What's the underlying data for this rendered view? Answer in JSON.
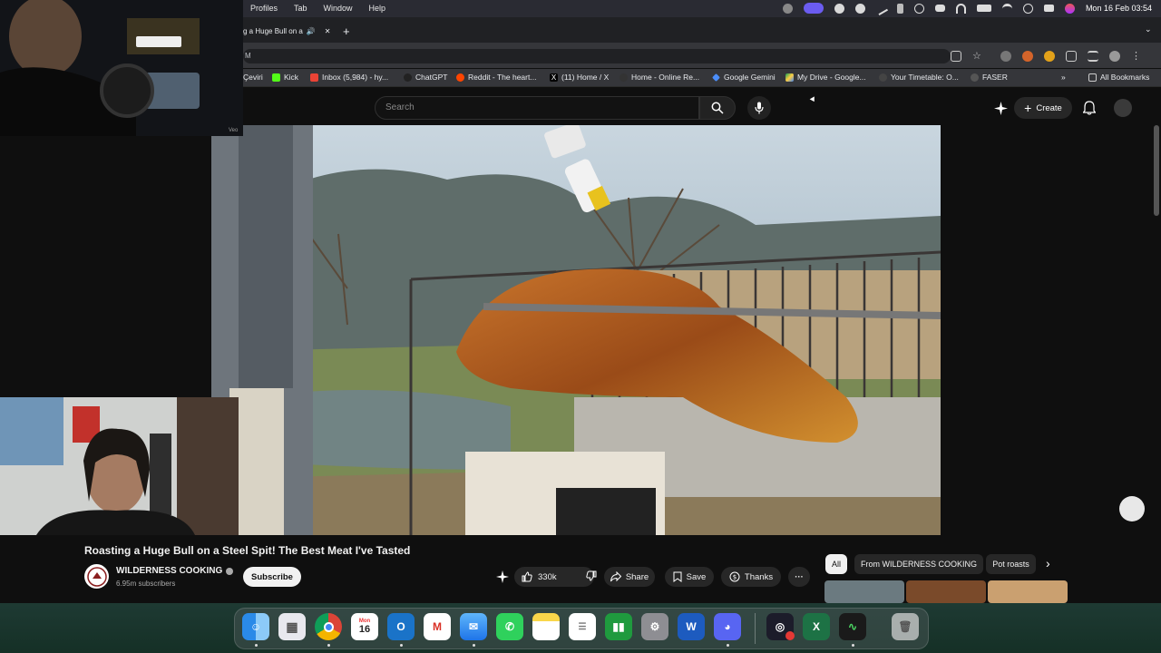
{
  "menubar": {
    "items": [
      "Profiles",
      "Tab",
      "Window",
      "Help"
    ],
    "clock": "Mon 16 Feb  03:54"
  },
  "browser": {
    "tab_title": "g a Huge Bull on a",
    "url": "M",
    "bookmarks": [
      "Çeviri",
      "Kick",
      "Inbox (5,984) - hy...",
      "ChatGPT",
      "Reddit - The heart...",
      "(11) Home / X",
      "Home - Online Re...",
      "Google Gemini",
      "My Drive - Google...",
      "Your Timetable: O...",
      "FASER"
    ],
    "all_bookmarks": "All Bookmarks",
    "more_glyph": "»"
  },
  "youtube": {
    "search_placeholder": "Search",
    "create_label": "Create",
    "video_title": "Roasting a Huge Bull on a Steel Spit! The Best Meat I've Tasted",
    "channel_name": "WILDERNESS COOKING",
    "subscribers": "6.95m subscribers",
    "subscribe_label": "Subscribe",
    "like_count": "330k",
    "share_label": "Share",
    "save_label": "Save",
    "thanks_label": "Thanks",
    "more_label": "···",
    "chips": [
      "All",
      "From WILDERNESS COOKING",
      "Pot roasts"
    ],
    "cam_watermark": "Veo",
    "avatar_text": "WILDERNESS COOKING"
  },
  "dock": {
    "apps": [
      "finder-icon",
      "launchpad-icon",
      "chrome-icon",
      "calendar-icon",
      "outlook-icon",
      "gmail-icon",
      "mail-icon",
      "whatsapp-icon",
      "notes-icon",
      "reminders-icon",
      "numbers-icon",
      "settings-icon",
      "word-icon",
      "discord-icon",
      "activity-icon",
      "excel-icon",
      "stocks-icon",
      "trash-icon"
    ],
    "calendar_month": "Mon",
    "calendar_day": "16"
  },
  "colors": {
    "menubar": "#2a2b33",
    "youtube_bg": "#0f0f0f",
    "accent_red": "#ff0000"
  }
}
